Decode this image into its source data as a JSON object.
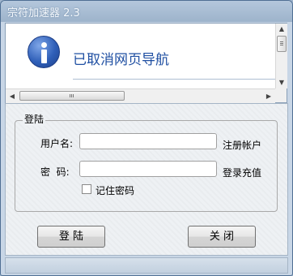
{
  "window": {
    "title": "宗符加速器 2.3"
  },
  "web": {
    "message": "已取消网页导航",
    "hscroll_grip": "III"
  },
  "login": {
    "group_title": "登陆",
    "username_label": "用户名:",
    "username_value": "",
    "register_link": "注册帐户",
    "password_label": "密  码:",
    "password_value": "",
    "recharge_link": "登录充值",
    "remember_label": "记住密码",
    "remember_checked": false
  },
  "buttons": {
    "login": "登  陆",
    "close": "关  闭"
  }
}
